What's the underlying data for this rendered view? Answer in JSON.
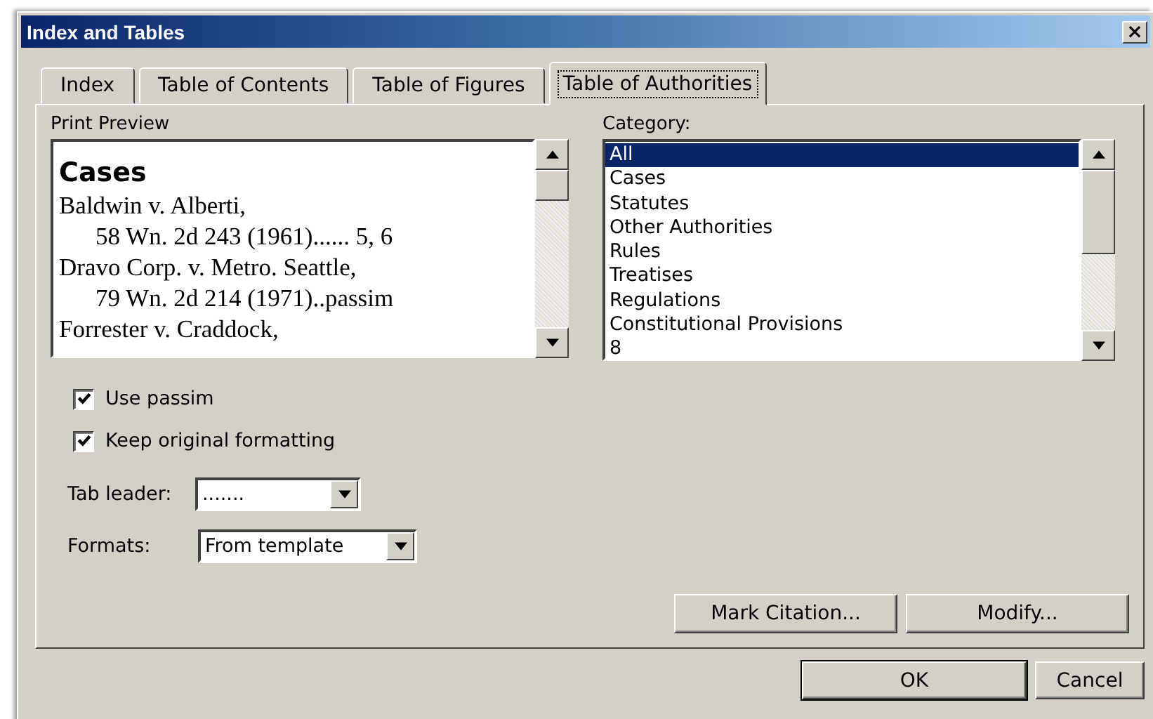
{
  "window": {
    "title": "Index and Tables",
    "close": "×"
  },
  "tabs": [
    {
      "label": "Index",
      "selected": false
    },
    {
      "label": "Table of Contents",
      "selected": false
    },
    {
      "label": "Table of Figures",
      "selected": false
    },
    {
      "label": "Table of Authorities",
      "selected": true
    }
  ],
  "print_preview": {
    "label": "Print Preview",
    "lines": [
      {
        "kind": "heading",
        "text": "Cases"
      },
      {
        "kind": "entry",
        "text": "Baldwin v. Alberti,"
      },
      {
        "kind": "pages",
        "text": "58 Wn. 2d 243 (1961)...... 5, 6"
      },
      {
        "kind": "entry",
        "text": "Dravo Corp. v. Metro. Seattle,"
      },
      {
        "kind": "pages",
        "text": "79 Wn. 2d 214 (1971)..passim"
      },
      {
        "kind": "entry",
        "text": "Forrester v. Craddock,"
      }
    ]
  },
  "category": {
    "label": "Category:",
    "items": [
      {
        "label": "All",
        "selected": true
      },
      {
        "label": "Cases",
        "selected": false
      },
      {
        "label": "Statutes",
        "selected": false
      },
      {
        "label": "Other Authorities",
        "selected": false
      },
      {
        "label": "Rules",
        "selected": false
      },
      {
        "label": "Treatises",
        "selected": false
      },
      {
        "label": "Regulations",
        "selected": false
      },
      {
        "label": "Constitutional Provisions",
        "selected": false
      },
      {
        "label": "8",
        "selected": false
      }
    ]
  },
  "options": [
    {
      "label": "Use passim",
      "checked": true
    },
    {
      "label": "Keep original formatting",
      "checked": true
    }
  ],
  "dropdowns": [
    {
      "label": "Tab leader:",
      "value": "......."
    },
    {
      "label": "Formats:",
      "value": "From template"
    }
  ],
  "panel_buttons": [
    {
      "label": "Mark Citation..."
    },
    {
      "label": "Modify..."
    }
  ],
  "dialog_buttons": [
    {
      "label": "OK",
      "default": true
    },
    {
      "label": "Cancel",
      "default": false
    }
  ]
}
